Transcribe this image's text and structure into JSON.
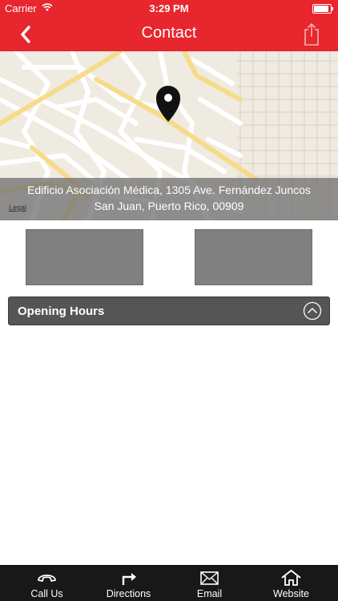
{
  "status_bar": {
    "carrier": "Carrier",
    "time": "3:29 PM",
    "battery_level": 0.9
  },
  "nav": {
    "title": "Contact",
    "back_icon": "chevron-left-icon",
    "share_icon": "share-icon"
  },
  "map": {
    "address_line1": "Edificio Asociación Médica, 1305 Ave. Fernández Juncos",
    "address_line2": "San Juan, Puerto Rico, 00909",
    "legal": "Legal",
    "pin_icon": "map-pin-icon"
  },
  "opening_hours": {
    "label": "Opening Hours",
    "icon": "chevron-up-circle-icon"
  },
  "tabs": [
    {
      "label": "Call Us",
      "icon": "phone-icon"
    },
    {
      "label": "Directions",
      "icon": "turn-right-arrow-icon"
    },
    {
      "label": "Email",
      "icon": "envelope-icon"
    },
    {
      "label": "Website",
      "icon": "home-icon"
    }
  ],
  "colors": {
    "accent": "#e8262d",
    "tabbar": "#181818",
    "hours_bar": "#555555",
    "placeholder": "#808080"
  }
}
